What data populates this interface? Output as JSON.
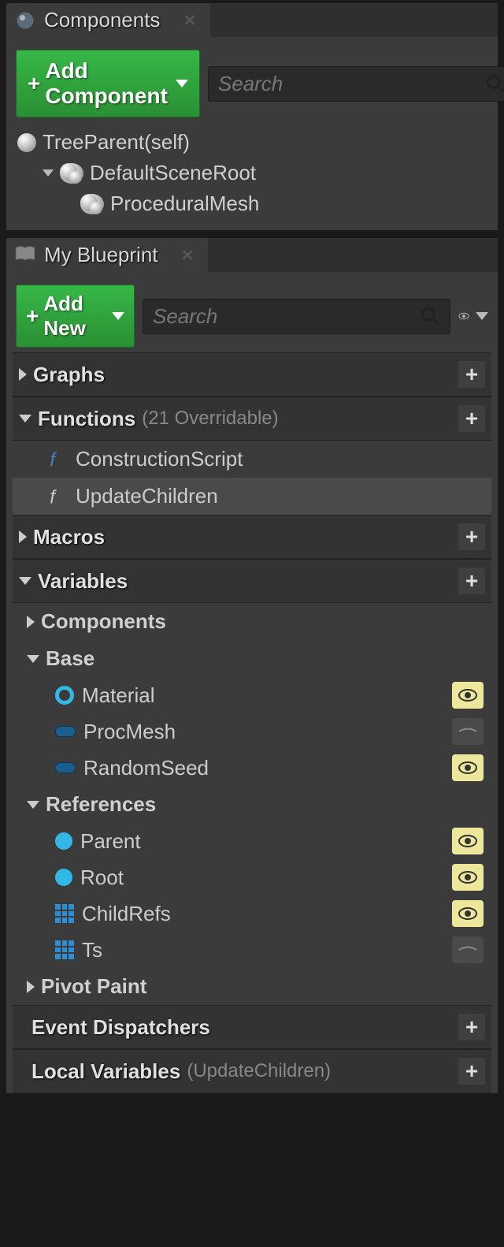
{
  "components_panel": {
    "tab_title": "Components",
    "add_button": "Add Component",
    "search_placeholder": "Search",
    "tree": {
      "root_self": "TreeParent(self)",
      "scene_root": "DefaultSceneRoot",
      "proc_mesh": "ProceduralMesh"
    }
  },
  "blueprint_panel": {
    "tab_title": "My Blueprint",
    "add_button": "Add New",
    "search_placeholder": "Search",
    "sections": {
      "graphs": {
        "title": "Graphs"
      },
      "functions": {
        "title": "Functions",
        "sub": "(21 Overridable)",
        "items": {
          "construction": "ConstructionScript",
          "update_children": "UpdateChildren"
        }
      },
      "macros": {
        "title": "Macros"
      },
      "variables": {
        "title": "Variables",
        "cats": {
          "components": "Components",
          "base": {
            "label": "Base",
            "items": {
              "material": "Material",
              "procmesh": "ProcMesh",
              "randomseed": "RandomSeed"
            }
          },
          "references": {
            "label": "References",
            "items": {
              "parent": "Parent",
              "root": "Root",
              "childrefs": "ChildRefs",
              "ts": "Ts"
            }
          },
          "pivotpaint": "Pivot Paint"
        }
      },
      "event_dispatchers": {
        "title": "Event Dispatchers"
      },
      "local_vars": {
        "title": "Local Variables",
        "sub": "(UpdateChildren)"
      }
    }
  }
}
